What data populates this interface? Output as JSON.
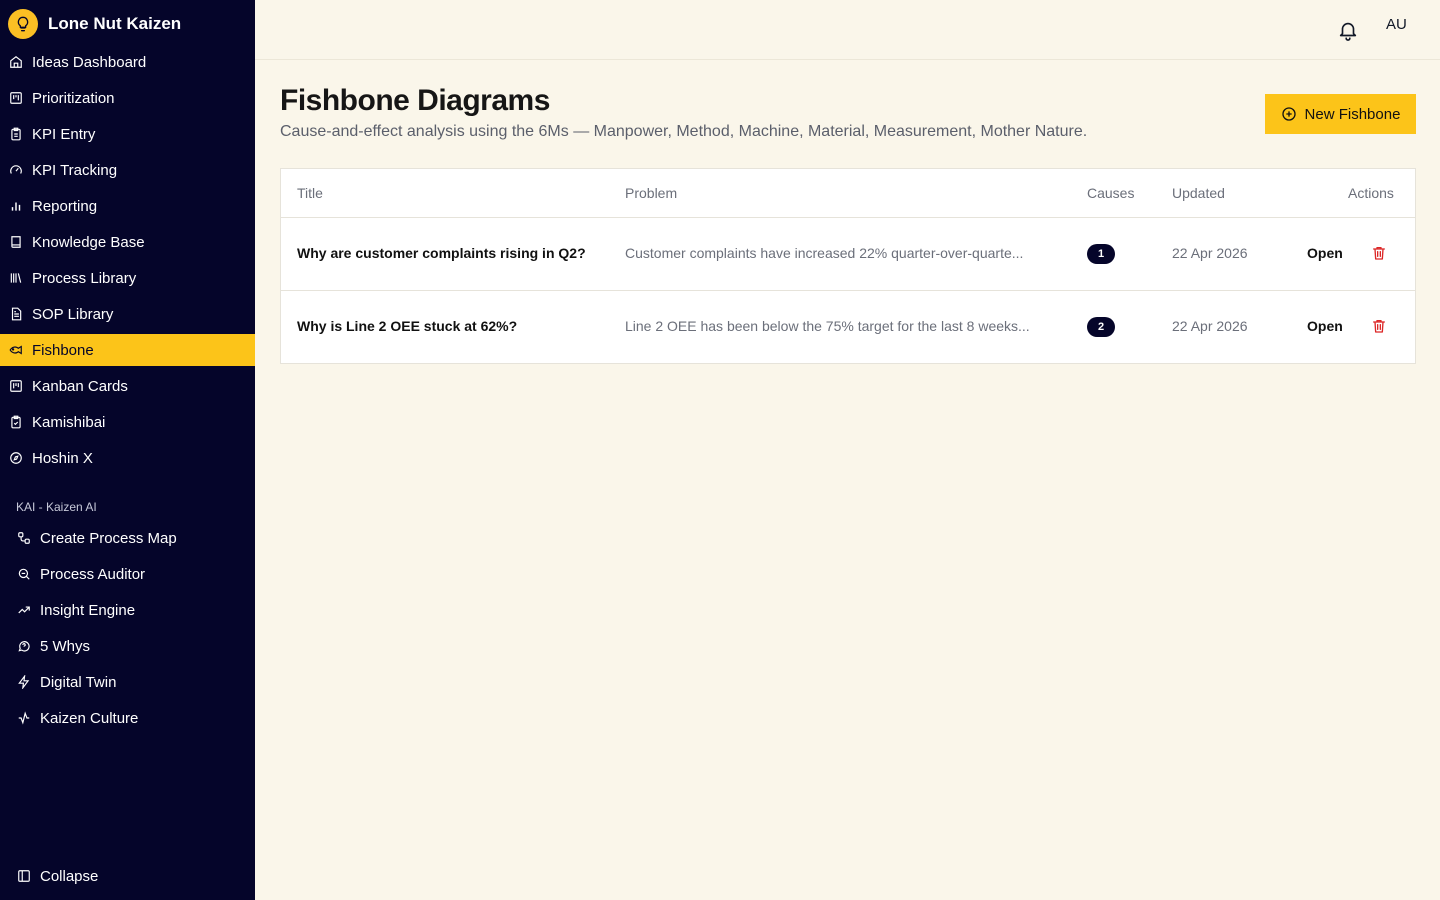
{
  "app": {
    "name": "Lone Nut Kaizen"
  },
  "sidebar": {
    "items": [
      {
        "label": "Ideas Dashboard",
        "icon": "home-icon"
      },
      {
        "label": "Prioritization",
        "icon": "board-icon"
      },
      {
        "label": "KPI Entry",
        "icon": "clipboard-icon"
      },
      {
        "label": "KPI Tracking",
        "icon": "gauge-icon"
      },
      {
        "label": "Reporting",
        "icon": "bar-chart-icon"
      },
      {
        "label": "Knowledge Base",
        "icon": "book-icon"
      },
      {
        "label": "Process Library",
        "icon": "library-icon"
      },
      {
        "label": "SOP Library",
        "icon": "document-icon"
      },
      {
        "label": "Fishbone",
        "icon": "fish-icon",
        "active": true
      },
      {
        "label": "Kanban Cards",
        "icon": "kanban-icon"
      },
      {
        "label": "Kamishibai",
        "icon": "clipboard-check-icon"
      },
      {
        "label": "Hoshin X",
        "icon": "compass-icon"
      }
    ],
    "kai_heading": "KAI - Kaizen AI",
    "kai_items": [
      {
        "label": "Create Process Map",
        "icon": "workflow-icon"
      },
      {
        "label": "Process Auditor",
        "icon": "search-zoom-icon"
      },
      {
        "label": "Insight Engine",
        "icon": "trending-up-icon"
      },
      {
        "label": "5 Whys",
        "icon": "message-question-icon"
      },
      {
        "label": "Digital Twin",
        "icon": "lightning-icon"
      },
      {
        "label": "Kaizen Culture",
        "icon": "activity-icon"
      }
    ],
    "collapse_label": "Collapse"
  },
  "topbar": {
    "avatar": "AU"
  },
  "page": {
    "title": "Fishbone Diagrams",
    "subtitle": "Cause-and-effect analysis using the 6Ms — Manpower, Method, Machine, Material, Measurement, Mother Nature.",
    "new_button": "New Fishbone"
  },
  "table": {
    "headers": {
      "title": "Title",
      "problem": "Problem",
      "causes": "Causes",
      "updated": "Updated",
      "actions": "Actions"
    },
    "rows": [
      {
        "title": "Why are customer complaints rising in Q2?",
        "problem": "Customer complaints have increased 22% quarter-over-quarte...",
        "causes": "1",
        "updated": "22 Apr 2026",
        "open": "Open"
      },
      {
        "title": "Why is Line 2 OEE stuck at 62%?",
        "problem": "Line 2 OEE has been below the 75% target for the last 8 weeks...",
        "causes": "2",
        "updated": "22 Apr 2026",
        "open": "Open"
      }
    ]
  },
  "colors": {
    "sidebar_bg": "#05052a",
    "accent": "#fcc419",
    "page_bg": "#faf6ea",
    "danger": "#dc2626"
  }
}
